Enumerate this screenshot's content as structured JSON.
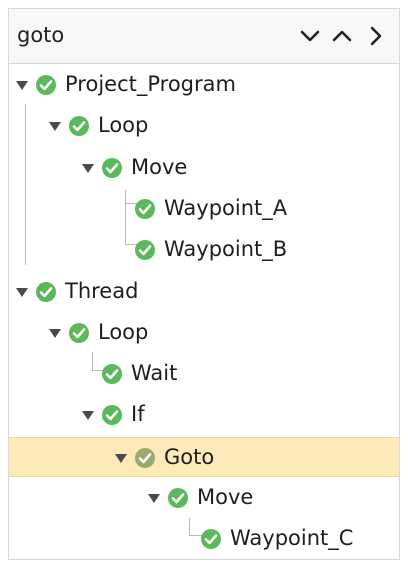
{
  "search": {
    "value": "goto"
  },
  "nav": {
    "next_icon": "chevron-down-icon",
    "prev_icon": "chevron-up-icon",
    "expand_icon": "chevron-right-icon"
  },
  "colors": {
    "status_ok": "#5cb85c",
    "status_selected": "#9aaa6e",
    "selection_bg": "#fde9b9"
  },
  "tree": {
    "nodes": [
      {
        "label": "Project_Program",
        "expanded": true,
        "status": "check-icon"
      },
      {
        "label": "Loop",
        "expanded": true,
        "status": "check-icon"
      },
      {
        "label": "Move",
        "expanded": true,
        "status": "check-icon"
      },
      {
        "label": "Waypoint_A",
        "status": "check-icon"
      },
      {
        "label": "Waypoint_B",
        "status": "check-icon"
      },
      {
        "label": "Thread",
        "expanded": true,
        "status": "check-icon"
      },
      {
        "label": "Loop",
        "expanded": true,
        "status": "check-icon"
      },
      {
        "label": "Wait",
        "status": "check-icon"
      },
      {
        "label": "If",
        "expanded": true,
        "status": "check-icon"
      },
      {
        "label": "Goto",
        "expanded": true,
        "status": "check-icon",
        "selected": true
      },
      {
        "label": "Move",
        "expanded": true,
        "status": "check-icon"
      },
      {
        "label": "Waypoint_C",
        "status": "check-icon"
      }
    ]
  }
}
